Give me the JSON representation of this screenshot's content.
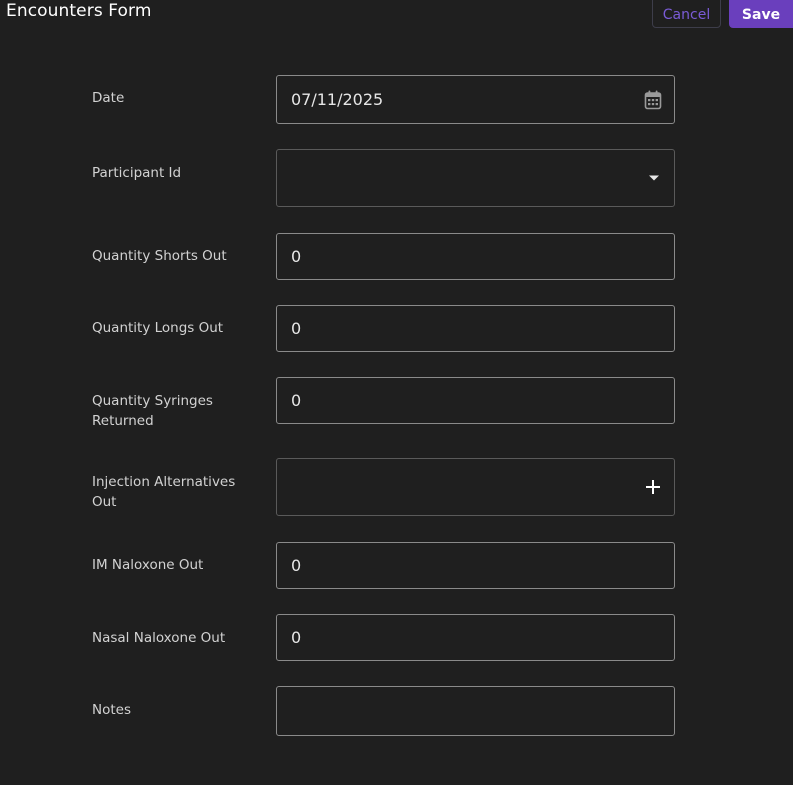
{
  "header": {
    "title": "Encounters Form",
    "cancel_label": "Cancel",
    "save_label": "Save"
  },
  "colors": {
    "accent": "#6a3fbd",
    "cancel_text": "#7a5bd6",
    "background": "#1f1f1f"
  },
  "form": {
    "date": {
      "label": "Date",
      "value": "07/11/2025",
      "icon": "calendar-icon"
    },
    "participant_id": {
      "label": "Participant Id",
      "value": "",
      "icon": "chevron-down-icon"
    },
    "quantity_shorts_out": {
      "label": "Quantity Shorts Out",
      "value": "0"
    },
    "quantity_longs_out": {
      "label": "Quantity Longs Out",
      "value": "0"
    },
    "quantity_syringes_returned": {
      "label": "Quantity Syringes Returned",
      "value": "0"
    },
    "injection_alternatives_out": {
      "label": "Injection Alternatives Out",
      "value": "",
      "icon": "plus-icon"
    },
    "im_naloxone_out": {
      "label": "IM Naloxone Out",
      "value": "0"
    },
    "nasal_naloxone_out": {
      "label": "Nasal Naloxone Out",
      "value": "0"
    },
    "notes": {
      "label": "Notes",
      "value": ""
    }
  }
}
